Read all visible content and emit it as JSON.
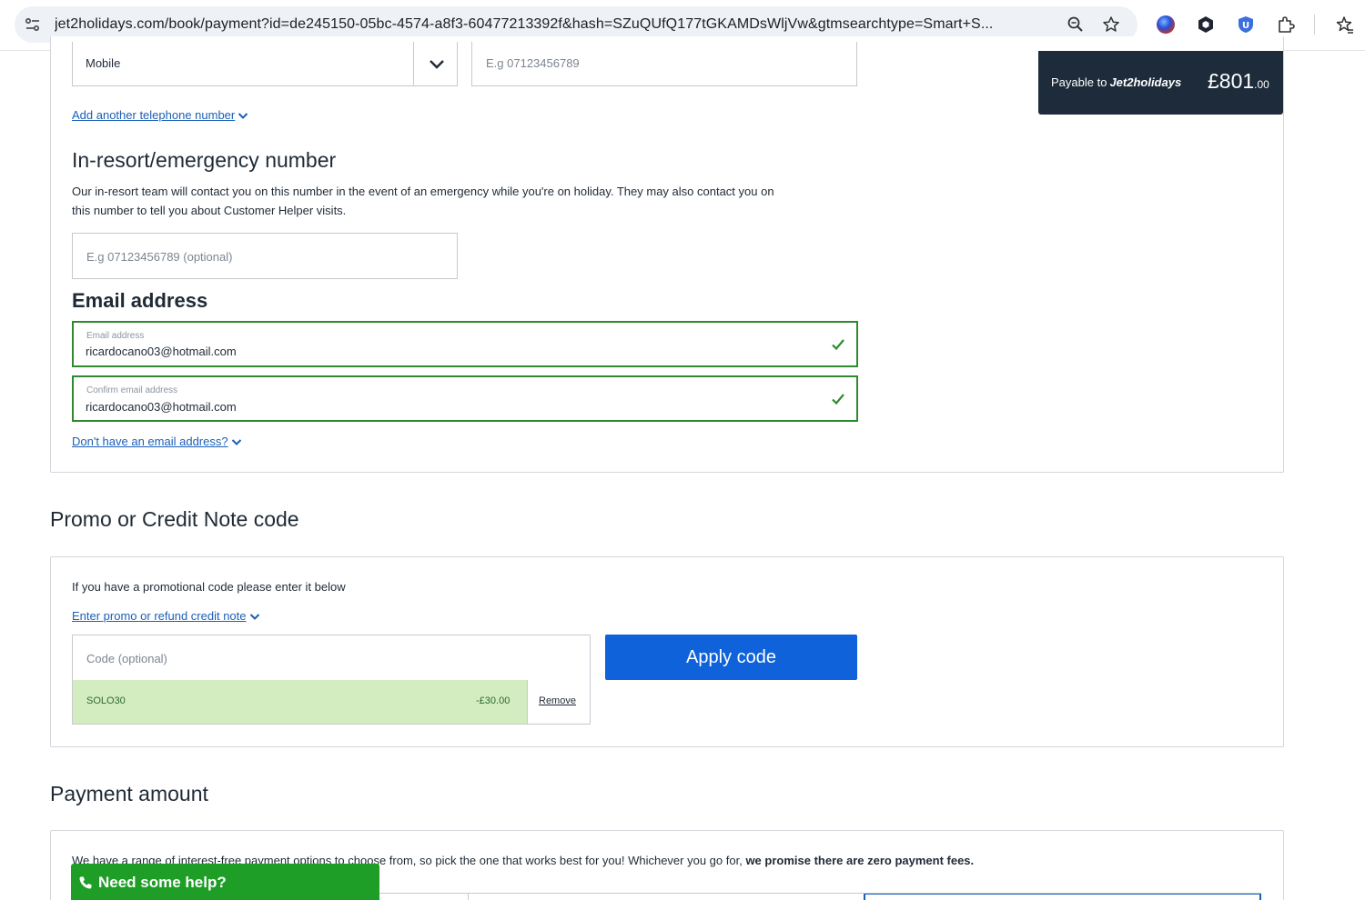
{
  "browser": {
    "url": "jet2holidays.com/book/payment?id=de245150-05bc-4574-a8f3-60477213392f&hash=SZuQUfQ177tGKAMDsWljVw&gtmsearchtype=Smart+S...",
    "icons": [
      "site-info-icon",
      "zoom-icon",
      "bookmark-star-icon",
      "extension-orb-icon",
      "extension-hex-icon",
      "extension-shield-icon",
      "extensions-puzzle-icon",
      "reading-list-icon"
    ]
  },
  "payable": {
    "label": "Payable to",
    "brand": "Jet2holidays",
    "amount": "£801",
    "pence": ".00"
  },
  "phone": {
    "type_value": "Mobile",
    "number_placeholder": "E.g 07123456789",
    "add_another_link": "Add another telephone number"
  },
  "emergency": {
    "heading": "In-resort/emergency number",
    "description_line1": "Our in-resort team will contact you on this number in the event of an emergency while you're on holiday. They may also contact you on",
    "description_line2": "this number to tell you about Customer Helper visits.",
    "placeholder": "E.g 07123456789 (optional)"
  },
  "email": {
    "heading": "Email address",
    "email_label": "Email address",
    "email_value": "ricardocano03@hotmail.com",
    "confirm_label": "Confirm email address",
    "confirm_value": "ricardocano03@hotmail.com",
    "no_email_link": "Don't have an email address?"
  },
  "promo": {
    "heading": "Promo or Credit Note code",
    "intro": "If you have a promotional code please enter it below",
    "enter_link": "Enter promo or refund credit note",
    "code_placeholder": "Code (optional)",
    "apply_button": "Apply code",
    "applied_code": "SOLO30",
    "applied_amount": "-£30.00",
    "remove_link": "Remove"
  },
  "payment": {
    "heading": "Payment amount",
    "intro_start": "We have a range of interest-free payment options to choose from, so pick the one that works best for you! Whichever you go for,",
    "intro_bold": "we promise there are zero payment fees."
  },
  "help": {
    "label": "Need some help?"
  },
  "colors": {
    "brand_dark": "#1d2b3a",
    "link_blue": "#1c5fb7",
    "button_blue": "#0f62d9",
    "valid_green": "#2f8a2f",
    "applied_bg": "#d4edc0",
    "help_green": "#1e9e26"
  }
}
